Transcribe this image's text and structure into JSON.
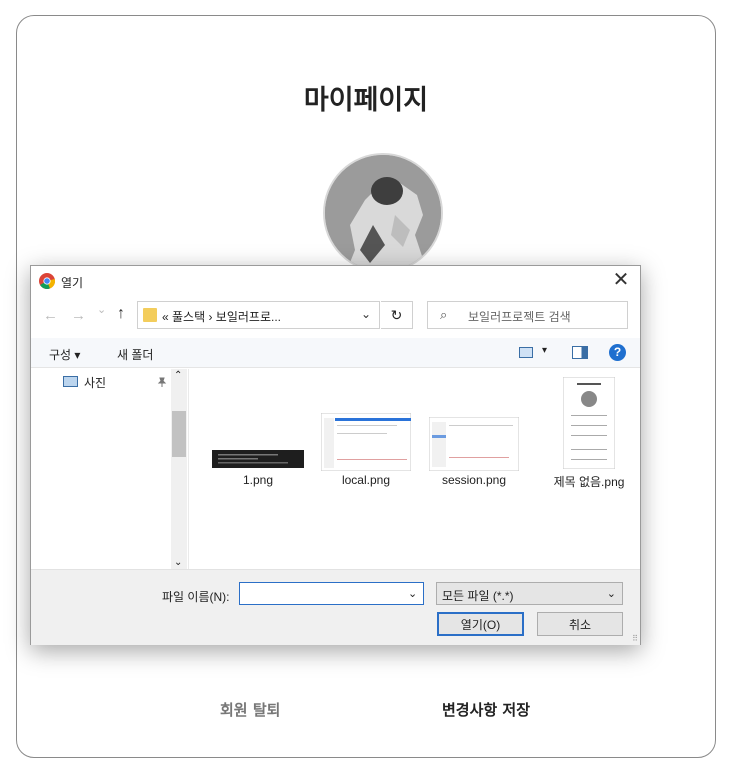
{
  "page": {
    "title": "마이페이지",
    "withdraw_label": "회원 탈퇴",
    "save_label": "변경사항 저장"
  },
  "dialog": {
    "title": "열기",
    "close_glyph": "✕",
    "nav": {
      "back_glyph": "←",
      "forward_glyph": "→",
      "recent_glyph": "⌄",
      "up_glyph": "↑",
      "breadcrumb": "« 풀스택 › 보일러프로...",
      "dropdown_glyph": "⌄",
      "refresh_glyph": "↻",
      "search_placeholder": "보일러프로젝트 검색",
      "search_glyph": "⌕"
    },
    "toolbar": {
      "organize": "구성 ▾",
      "new_folder": "새 폴더",
      "view_caret": "▾",
      "help": "?"
    },
    "nav_pane": {
      "pictures": "사진",
      "pin_glyph": "📌",
      "scroll_up": "⌃",
      "scroll_down": "⌄"
    },
    "files": [
      {
        "name": "1.png"
      },
      {
        "name": "local.png"
      },
      {
        "name": "session.png"
      },
      {
        "name": "제목 없음.png"
      }
    ],
    "footer": {
      "filename_label": "파일 이름(N):",
      "filename_value": "",
      "filename_caret": "⌄",
      "type_value": "모든 파일 (*.*)",
      "type_caret": "⌄",
      "open_label": "열기(O)",
      "cancel_label": "취소"
    }
  }
}
